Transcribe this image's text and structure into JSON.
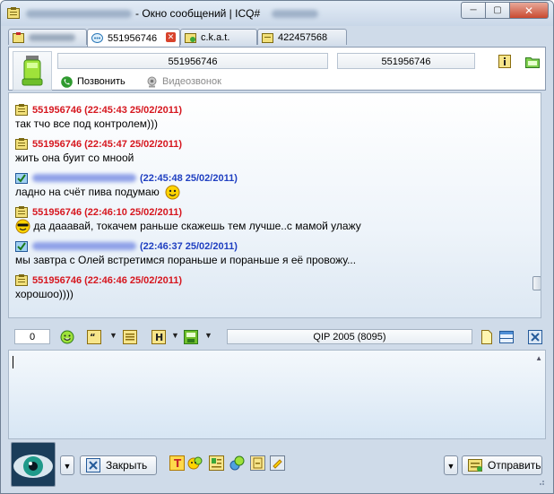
{
  "window": {
    "title": "- Окно сообщений | ICQ#",
    "controls": {
      "minimize": "─",
      "maximize": "▢",
      "close": "✕"
    }
  },
  "tabs": [
    {
      "label": "",
      "icon": "contact-card-icon",
      "blurred": true
    },
    {
      "label": "551956746",
      "icon": "chat-bubble-icon",
      "active": true,
      "close": "✕"
    },
    {
      "label": "c.k.a.t.",
      "icon": "contact-card-icon"
    },
    {
      "label": "422457568",
      "icon": "contact-card-icon"
    }
  ],
  "contact_panel": {
    "field_left": "551956746",
    "field_right": "551956746",
    "call_label": "Позвонить",
    "video_label": "Видеозвонок"
  },
  "messages": [
    {
      "sender": "551956746",
      "time": "(22:45:43 25/02/2011)",
      "text": "так тчо все под контролем)))",
      "side": "me"
    },
    {
      "sender": "551956746",
      "time": "(22:45:47 25/02/2011)",
      "text": "жить она буит со мноой",
      "side": "me"
    },
    {
      "sender": "",
      "time": "(22:45:48 25/02/2011)",
      "text": "ладно на счёт пива подумаю",
      "side": "them",
      "smiley": "smile"
    },
    {
      "sender": "551956746",
      "time": "(22:46:10 25/02/2011)",
      "text": "да дааавай, токачем раньше скажешь тем лучше..с мамой улажу",
      "side": "me",
      "smiley": "cool"
    },
    {
      "sender": "",
      "time": "(22:46:37 25/02/2011)",
      "text": "мы завтра с Олей встретимся пораньше и пораньше я её провожу...",
      "side": "them"
    },
    {
      "sender": "551956746",
      "time": "(22:46:46 25/02/2011)",
      "text": "хорошоо))))",
      "side": "me"
    }
  ],
  "toolbar": {
    "char_count": "0",
    "client_version": "QIP 2005 (8095)"
  },
  "bottom": {
    "close_label": "Закрыть",
    "send_label": "Отправить"
  },
  "colors": {
    "own_message": "#d6161e",
    "their_message": "#1f3fc1",
    "frame": "#cfdbe9"
  }
}
